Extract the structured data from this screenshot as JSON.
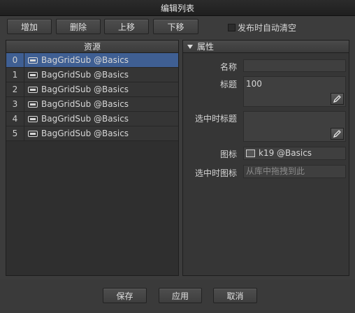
{
  "window": {
    "title": "编辑列表"
  },
  "toolbar": {
    "add_label": "增加",
    "delete_label": "删除",
    "move_up_label": "上移",
    "move_down_label": "下移",
    "clear_on_publish_label": "发布时自动清空",
    "clear_on_publish_checked": false
  },
  "list": {
    "header": "资源",
    "selected_index": 0,
    "items": [
      {
        "index": "0",
        "name": "BagGridSub @Basics",
        "icon": "component-icon"
      },
      {
        "index": "1",
        "name": "BagGridSub @Basics",
        "icon": "component-icon"
      },
      {
        "index": "2",
        "name": "BagGridSub @Basics",
        "icon": "component-icon"
      },
      {
        "index": "3",
        "name": "BagGridSub @Basics",
        "icon": "component-icon"
      },
      {
        "index": "4",
        "name": "BagGridSub @Basics",
        "icon": "component-icon"
      },
      {
        "index": "5",
        "name": "BagGridSub @Basics",
        "icon": "component-icon"
      }
    ]
  },
  "properties": {
    "header": "属性",
    "name_label": "名称",
    "name_value": "",
    "title_label": "标题",
    "title_value": "100",
    "selected_title_label": "选中时标题",
    "selected_title_value": "",
    "icon_label": "图标",
    "icon_value": "k19 @Basics",
    "selected_icon_label": "选中时图标",
    "selected_icon_placeholder": "从库中拖拽到此"
  },
  "footer": {
    "save_label": "保存",
    "apply_label": "应用",
    "cancel_label": "取消"
  }
}
